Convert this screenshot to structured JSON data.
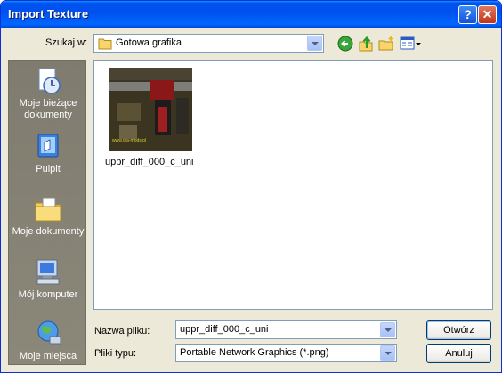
{
  "window": {
    "title": "Import Texture",
    "help_label": "?",
    "close_label": "✕"
  },
  "toolbar": {
    "look_in_label": "Szukaj w:",
    "look_in_value": "Gotowa grafika"
  },
  "places": [
    {
      "label": "Moje bieżące dokumenty",
      "icon": "recent-documents-icon"
    },
    {
      "label": "Pulpit",
      "icon": "desktop-icon"
    },
    {
      "label": "Moje dokumenty",
      "icon": "my-documents-icon"
    },
    {
      "label": "Mój komputer",
      "icon": "my-computer-icon"
    },
    {
      "label": "Moje miejsca",
      "icon": "network-places-icon"
    }
  ],
  "files": [
    {
      "name": "uppr_diff_000_c_uni",
      "thumbnail_caption": "www.gta-mods.pl"
    }
  ],
  "form": {
    "filename_label": "Nazwa pliku:",
    "filename_value": "uppr_diff_000_c_uni",
    "filetype_label": "Pliki typu:",
    "filetype_value": "Portable Network Graphics (*.png)"
  },
  "buttons": {
    "open": "Otwórz",
    "cancel": "Anuluj"
  },
  "colors": {
    "titlebar": "#0053ee",
    "dialog_bg": "#ece9d8",
    "places_bg": "#7f7c6f"
  }
}
